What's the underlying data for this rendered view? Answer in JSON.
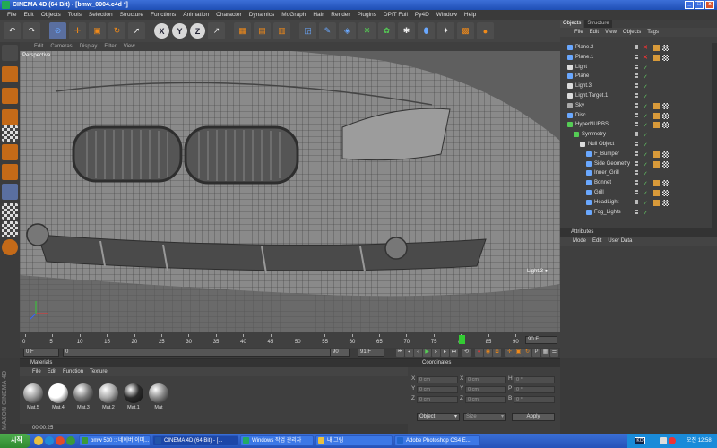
{
  "window": {
    "title": "CINEMA 4D (64 Bit) - [bmw_0004.c4d *]"
  },
  "menu": [
    "File",
    "Edit",
    "Objects",
    "Tools",
    "Selection",
    "Structure",
    "Functions",
    "Animation",
    "Character",
    "Dynamics",
    "MoGraph",
    "Hair",
    "Render",
    "Plugins",
    "DPIT Full",
    "Py4D",
    "Window",
    "Help"
  ],
  "viewport": {
    "menu": [
      "Edit",
      "Cameras",
      "Display",
      "Filter",
      "View"
    ],
    "label": "Perspective",
    "camera_label": "Light.3 ●"
  },
  "object_manager": {
    "tabs": [
      "Objects",
      "Structure"
    ],
    "menu": [
      "File",
      "Edit",
      "View",
      "Objects",
      "Tags"
    ],
    "rows": [
      {
        "name": "Plane.2",
        "indent": 0
      },
      {
        "name": "Plane.1",
        "indent": 0
      },
      {
        "name": "Light",
        "indent": 0
      },
      {
        "name": "Plane",
        "indent": 0
      },
      {
        "name": "Light.3",
        "indent": 0
      },
      {
        "name": "Light.Target.1",
        "indent": 0
      },
      {
        "name": "Sky",
        "indent": 0
      },
      {
        "name": "Disc",
        "indent": 0
      },
      {
        "name": "HyperNURBS",
        "indent": 0
      },
      {
        "name": "Symmetry",
        "indent": 1
      },
      {
        "name": "Null Object",
        "indent": 2
      },
      {
        "name": "F_Bumper",
        "indent": 3
      },
      {
        "name": "Side Geometry",
        "indent": 3
      },
      {
        "name": "Inner_Grill",
        "indent": 3
      },
      {
        "name": "Bonnet",
        "indent": 3
      },
      {
        "name": "Grill",
        "indent": 3
      },
      {
        "name": "HeadLight",
        "indent": 3
      },
      {
        "name": "Fog_Lights",
        "indent": 3
      }
    ]
  },
  "attributes": {
    "title": "Attributes",
    "menu": [
      "Mode",
      "Edit",
      "User Data"
    ]
  },
  "timeline": {
    "ticks": [
      "0",
      "5",
      "10",
      "15",
      "20",
      "25",
      "30",
      "35",
      "40",
      "45",
      "50",
      "55",
      "60",
      "65",
      "70",
      "75",
      "80",
      "85",
      "90"
    ],
    "current_frame_label": "80",
    "end_label": "90 F",
    "start_field": "0 F",
    "min_field": "0",
    "max_field": "90",
    "end_field": "91 F",
    "playhead_fraction": 0.89
  },
  "materials": {
    "title": "Materials",
    "menu": [
      "File",
      "Edit",
      "Function",
      "Texture"
    ],
    "items": [
      {
        "name": "Mat.5",
        "color": "#9a9a9a"
      },
      {
        "name": "Mat.4",
        "color": "#ffffff"
      },
      {
        "name": "Mat.3",
        "color": "#7c7c7c"
      },
      {
        "name": "Mat.2",
        "color": "#a8a8a8"
      },
      {
        "name": "Mat.1",
        "color": "#2a2a2a"
      },
      {
        "name": "Mat",
        "color": "#8a8a8a"
      }
    ]
  },
  "coordinates": {
    "title": "Coordinates",
    "rows": [
      {
        "a": "X",
        "av": "0 cm",
        "b": "X",
        "bv": "0 cm",
        "c": "H",
        "cv": "0 °"
      },
      {
        "a": "Y",
        "av": "0 cm",
        "b": "Y",
        "bv": "0 cm",
        "c": "P",
        "cv": "0 °"
      },
      {
        "a": "Z",
        "av": "0 cm",
        "b": "Z",
        "bv": "0 cm",
        "c": "B",
        "cv": "0 °"
      }
    ],
    "mode_select": "Object",
    "size_select": "Size",
    "apply": "Apply"
  },
  "status": {
    "time": "00:00:25"
  },
  "taskbar": {
    "start": "시작",
    "tasks": [
      {
        "label": "bmw 530 :: 네이버 이미...",
        "icon_color": "#3a9a3a"
      },
      {
        "label": "CINEMA 4D (64 Bit) - [...",
        "icon_color": "#2255aa"
      },
      {
        "label": "Windows 작업 관리자",
        "icon_color": "#2a6"
      },
      {
        "label": "내 그림",
        "icon_color": "#e8c040"
      },
      {
        "label": "Adobe Photoshop CS4 E...",
        "icon_color": "#2266cc"
      }
    ],
    "tray": {
      "lang": "KO",
      "time": "오전 12:58"
    }
  }
}
